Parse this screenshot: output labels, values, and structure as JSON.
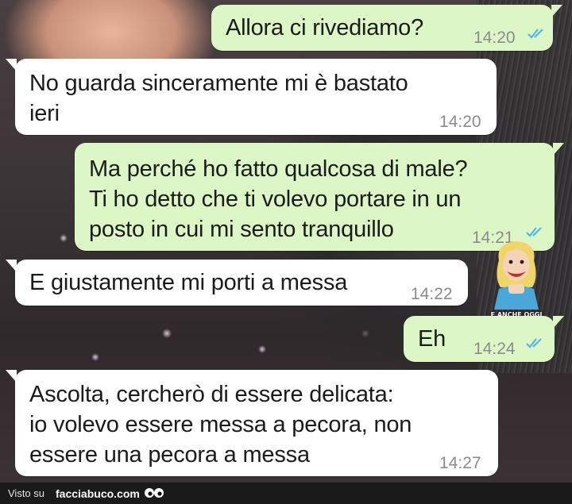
{
  "messages": [
    {
      "direction": "out",
      "text": "Allora ci rivediamo?",
      "time": "14:20",
      "read": true
    },
    {
      "direction": "in",
      "text": "No guarda sinceramente mi è bastato\nieri",
      "time": "14:20"
    },
    {
      "direction": "out",
      "text": "Ma perché ho fatto qualcosa di male?\nTi ho detto che ti volevo portare in un\nposto in cui mi sento tranquillo",
      "time": "14:21",
      "read": true
    },
    {
      "direction": "in",
      "text": "E giustamente mi porti a messa",
      "time": "14:22"
    },
    {
      "direction": "out",
      "text": "Eh",
      "time": "14:24",
      "read": true
    },
    {
      "direction": "in",
      "text": "Ascolta, cercherò di essere delicata:\nio volevo essere messa a pecora, non\nessere una pecora a messa",
      "time": "14:27"
    }
  ],
  "sticker": {
    "caption": "E ANCHE OGGI\nSI RIMORCHIA DOMANI"
  },
  "footer": {
    "prefix": "Visto su",
    "site": "facciabuco.com"
  },
  "colors": {
    "outgoing_bubble": "#ddf6c6",
    "incoming_bubble": "#ffffff",
    "read_ticks": "#4fb6ec",
    "timestamp": "#8b8b8b"
  }
}
